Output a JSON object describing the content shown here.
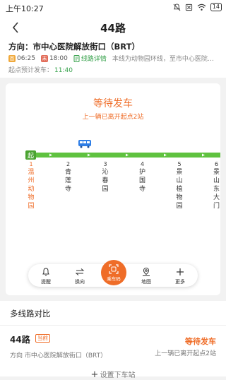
{
  "status_bar": {
    "time": "上午10:27",
    "battery": "14"
  },
  "header": {
    "title": "44路"
  },
  "route_info": {
    "direction": "方向：市中心医院解放街口（BRT）",
    "first_tag": "首",
    "first_time": "06:25",
    "last_tag": "末",
    "last_time": "18:00",
    "detail_link": "线路详情",
    "note": "本线为动物园环线，至市中心医院解放街口",
    "estimate_label": "起点预计发车：",
    "estimate_time": "11:40"
  },
  "bus_status": {
    "title": "等待发车",
    "subtitle": "上一辆已离开起点2站"
  },
  "route_map": {
    "start_badge": "起",
    "stops": [
      {
        "num": "1",
        "name": "温州动物园"
      },
      {
        "num": "2",
        "name": "青莲寺"
      },
      {
        "num": "3",
        "name": "沁春园"
      },
      {
        "num": "4",
        "name": "护国寺"
      },
      {
        "num": "5",
        "name": "景山植物园"
      },
      {
        "num": "6",
        "name": "景山东大门"
      }
    ]
  },
  "dock": {
    "remind": "提醒",
    "switch": "换向",
    "ride_code": "乘车码",
    "map": "地图",
    "more": "更多"
  },
  "multi_route": {
    "title": "多线路对比",
    "line": "44路",
    "current_badge": "当前",
    "direction": "方向 市中心医院解放街口（BRT）",
    "status": "等待发车",
    "sub": "上一辆已离开起点2站",
    "set_stop": "设置下车站"
  },
  "colors": {
    "accent": "#ef6d28",
    "route_green": "#5fc23f",
    "link_green": "#35a14a",
    "bus_blue": "#2f7ee6"
  }
}
